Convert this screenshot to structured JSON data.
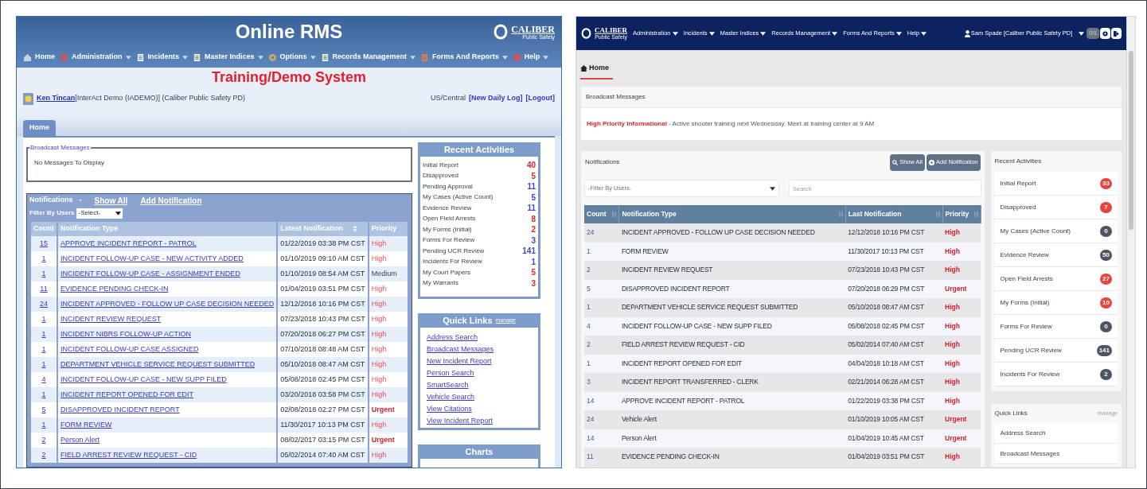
{
  "legacy": {
    "title": "Online RMS",
    "logo": {
      "name": "CALIBER",
      "sub": "Public Safety"
    },
    "menu": [
      {
        "label": "Home",
        "caret": false
      },
      {
        "label": "Administration",
        "caret": true
      },
      {
        "label": "Incidents",
        "caret": true
      },
      {
        "label": "Master Indices",
        "caret": true
      },
      {
        "label": "Options",
        "caret": true
      },
      {
        "label": "Records Management",
        "caret": true
      },
      {
        "label": "Forms And Reports",
        "caret": true
      },
      {
        "label": "Help",
        "caret": true
      }
    ],
    "system_banner": "Training/Demo System",
    "user": {
      "name": "Ken Tincan",
      "info": "[InterAct Demo (IADEMO)] (Caliber Public Safety PD)",
      "timezone": "US/Central",
      "links": [
        "[New Daily Log]",
        "[Logout]"
      ]
    },
    "tabs": [
      {
        "label": "Home",
        "selected": true
      }
    ],
    "broadcast": {
      "legend": "Broadcast Messages",
      "message": "No Messages To Display"
    },
    "notifications": {
      "title": "Notifications",
      "separator": "-",
      "links": [
        "Show All",
        "Add Notification"
      ],
      "filter_label": "Filter By Users",
      "filter_value": "-Select-",
      "columns": [
        "Count",
        "Notification Type",
        "Latest Notification",
        "Priority"
      ],
      "rows": [
        {
          "count": "15",
          "type": "APPROVE INCIDENT REPORT - PATROL",
          "date": "01/22/2019 03:38 PM CST",
          "priority": "High",
          "kind": "high"
        },
        {
          "count": "1",
          "type": "INCIDENT FOLLOW-UP CASE - NEW ACTIVITY ADDED",
          "date": "01/10/2019 09:10 AM CST",
          "priority": "High",
          "kind": "high"
        },
        {
          "count": "1",
          "type": "INCIDENT FOLLOW-UP CASE - ASSIGNMENT ENDED",
          "date": "01/10/2019 08:54 AM CST",
          "priority": "Medium",
          "kind": "medium"
        },
        {
          "count": "11",
          "type": "EVIDENCE PENDING CHECK-IN",
          "date": "01/04/2019 03:51 PM CST",
          "priority": "High",
          "kind": "high"
        },
        {
          "count": "24",
          "type": "INCIDENT APPROVED - FOLLOW UP CASE DECISION NEEDED",
          "date": "12/12/2018 10:16 PM CST",
          "priority": "High",
          "kind": "high"
        },
        {
          "count": "1",
          "type": "INCIDENT REVIEW REQUEST",
          "date": "07/23/2018 10:43 PM CST",
          "priority": "High",
          "kind": "high"
        },
        {
          "count": "1",
          "type": "INCIDENT NIBRS FOLLOW-UP ACTION",
          "date": "07/20/2018 06:27 PM CST",
          "priority": "High",
          "kind": "high"
        },
        {
          "count": "1",
          "type": "INCIDENT FOLLOW-UP CASE ASSIGNED",
          "date": "07/10/2018 08:48 AM CST",
          "priority": "High",
          "kind": "high"
        },
        {
          "count": "1",
          "type": "DEPARTMENT VEHICLE SERVICE REQUEST SUBMITTED",
          "date": "05/10/2018 08:47 AM CST",
          "priority": "High",
          "kind": "high"
        },
        {
          "count": "4",
          "type": "INCIDENT FOLLOW-UP CASE - NEW SUPP FILED",
          "date": "05/08/2018 02:45 PM CST",
          "priority": "High",
          "kind": "high"
        },
        {
          "count": "1",
          "type": "INCIDENT REPORT OPENED FOR EDIT",
          "date": "03/20/2018 03:58 PM CST",
          "priority": "High",
          "kind": "high"
        },
        {
          "count": "5",
          "type": "DISAPPROVED INCIDENT REPORT",
          "date": "02/08/2018 02:27 PM CST",
          "priority": "Urgent",
          "kind": "urgent"
        },
        {
          "count": "1",
          "type": "FORM REVIEW",
          "date": "11/30/2017 10:13 PM CST",
          "priority": "High",
          "kind": "high"
        },
        {
          "count": "2",
          "type": "Person Alert",
          "date": "08/02/2017 03:15 PM CST",
          "priority": "Urgent",
          "kind": "urgent"
        },
        {
          "count": "2",
          "type": "FIELD ARREST REVIEW REQUEST - CID",
          "date": "05/02/2014 07:40 AM CST",
          "priority": "High",
          "kind": "high"
        }
      ]
    },
    "recent_activities": {
      "title": "Recent Activities",
      "items": [
        {
          "label": "Initial Report",
          "count": "40",
          "color": "#e0252c"
        },
        {
          "label": "Disapproved",
          "count": "5",
          "color": "#e0252c"
        },
        {
          "label": "Pending Approval",
          "count": "11",
          "color": "#4545c8"
        },
        {
          "label": "My Cases (Active Count)",
          "count": "5",
          "color": "#4545c8"
        },
        {
          "label": "Evidence Review",
          "count": "11",
          "color": "#4545c8"
        },
        {
          "label": "Open Field Arrests",
          "count": "8",
          "color": "#e0252c"
        },
        {
          "label": "My Forms (Initial)",
          "count": "2",
          "color": "#e0252c"
        },
        {
          "label": "Forms For Review",
          "count": "3",
          "color": "#4545c8"
        },
        {
          "label": "Pending UCR Review",
          "count": "141",
          "color": "#4545c8"
        },
        {
          "label": "Incidents For Review",
          "count": "1",
          "color": "#4545c8"
        },
        {
          "label": "My Court Papers",
          "count": "5",
          "color": "#e0252c"
        },
        {
          "label": "My Warrants",
          "count": "3",
          "color": "#e0252c"
        }
      ]
    },
    "quick_links": {
      "title": "Quick Links",
      "manage": "manage",
      "items": [
        "Address Search",
        "Broadcast Messages",
        "New Incident Report",
        "Person Search",
        "SmartSearch",
        "Vehicle Search",
        "View Citations",
        "View Incident Report"
      ]
    },
    "charts": {
      "title": "Charts"
    }
  },
  "modern": {
    "logo": {
      "name": "CALIBER",
      "sub": "Public Safety"
    },
    "menu": [
      "Administration",
      "Incidents",
      "Master Indices",
      "Records Management",
      "Forms And Reports",
      "Help"
    ],
    "user": "Sam Spade [Caliber Public Safety PD]",
    "counter": "0/1",
    "breadcrumb": "Home",
    "broadcast": {
      "title": "Broadcast Messages",
      "priority": "High Priority Informational",
      "message": " - Active shooter training next Wednesday. Meet at training center at 9 AM"
    },
    "notifications": {
      "title": "Notifications",
      "buttons": [
        "Show All",
        "Add Notification"
      ],
      "filter_placeholder": "-Filter By Users-",
      "search_placeholder": "Search",
      "columns": [
        "Count",
        "Notification Type",
        "Last Notification",
        "Priority"
      ],
      "rows": [
        {
          "count": "24",
          "type": "INCIDENT APPROVED - FOLLOW UP CASE DECISION NEEDED",
          "date": "12/12/2018 10:16 PM CST",
          "priority": "High"
        },
        {
          "count": "1",
          "type": "FORM REVIEW",
          "date": "11/30/2017 10:13 PM CST",
          "priority": "High"
        },
        {
          "count": "2",
          "type": "INCIDENT REVIEW REQUEST",
          "date": "07/23/2018 10:43 PM CST",
          "priority": "High"
        },
        {
          "count": "5",
          "type": "DISAPPROVED INCIDENT REPORT",
          "date": "07/20/2018 06:29 PM CST",
          "priority": "Urgent"
        },
        {
          "count": "1",
          "type": "DEPARTMENT VEHICLE SERVICE REQUEST SUBMITTED",
          "date": "05/10/2018 08:47 AM CST",
          "priority": "High"
        },
        {
          "count": "4",
          "type": "INCIDENT FOLLOW-UP CASE - NEW SUPP FILED",
          "date": "05/08/2018 02:45 PM CST",
          "priority": "High"
        },
        {
          "count": "2",
          "type": "FIELD ARREST REVIEW REQUEST - CID",
          "date": "05/02/2014 07:40 AM CST",
          "priority": "High"
        },
        {
          "count": "1",
          "type": "INCIDENT REPORT OPENED FOR EDIT",
          "date": "04/04/2018 10:18 AM CST",
          "priority": "High"
        },
        {
          "count": "3",
          "type": "INCIDENT REPORT TRANSFERRED - CLERK",
          "date": "02/21/2014 06:28 AM CST",
          "priority": "High"
        },
        {
          "count": "14",
          "type": "APPROVE INCIDENT REPORT - PATROL",
          "date": "01/22/2019 03:38 PM CST",
          "priority": "High"
        },
        {
          "count": "24",
          "type": "Vehicle Alert",
          "date": "01/10/2019 10:05 AM CST",
          "priority": "Urgent"
        },
        {
          "count": "14",
          "type": "Person Alert",
          "date": "01/04/2019 10:45 AM CST",
          "priority": "Urgent"
        },
        {
          "count": "11",
          "type": "EVIDENCE PENDING CHECK-IN",
          "date": "01/04/2019 03:51 PM CST",
          "priority": "High"
        }
      ]
    },
    "recent_activities": {
      "title": "Recent Activities",
      "items": [
        {
          "label": "Initial Report",
          "count": "33",
          "color": "#e8453c"
        },
        {
          "label": "Disapproved",
          "count": "7",
          "color": "#e8453c"
        },
        {
          "label": "My Cases (Active Count)",
          "count": "0",
          "color": "#4b5563"
        },
        {
          "label": "Evidence Review",
          "count": "50",
          "color": "#4b5563"
        },
        {
          "label": "Open Field Arrests",
          "count": "27",
          "color": "#e8453c"
        },
        {
          "label": "My Forms (Initial)",
          "count": "10",
          "color": "#e8453c"
        },
        {
          "label": "Forms For Review",
          "count": "0",
          "color": "#4b5563"
        },
        {
          "label": "Pending UCR Review",
          "count": "141",
          "color": "#4b5563"
        },
        {
          "label": "Incidents For Review",
          "count": "2",
          "color": "#4b5563"
        }
      ]
    },
    "quick_links": {
      "title": "Quick Links",
      "manage": "manage",
      "items": [
        "Address Search",
        "Broadcast Messages"
      ]
    }
  }
}
